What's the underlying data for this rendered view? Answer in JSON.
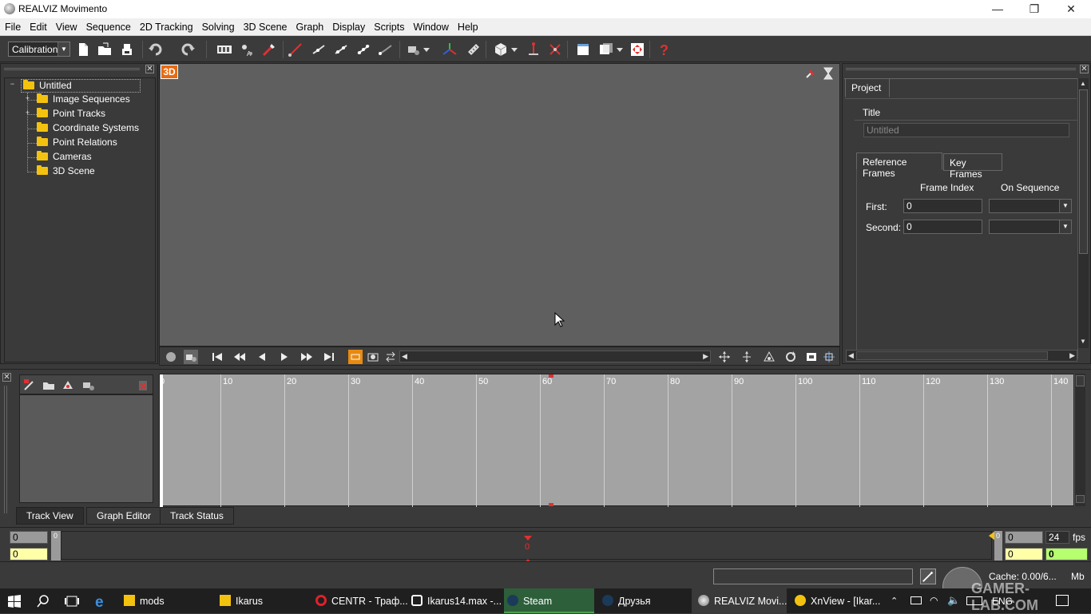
{
  "window": {
    "title": "REALVIZ Movimento",
    "minimize": "—",
    "maximize": "❐",
    "close": "✕"
  },
  "menu": [
    "File",
    "Edit",
    "View",
    "Sequence",
    "2D Tracking",
    "Solving",
    "3D Scene",
    "Graph",
    "Display",
    "Scripts",
    "Window",
    "Help"
  ],
  "toolbar": {
    "mode_select": "Calibration"
  },
  "tree": {
    "root": "Untitled",
    "items": [
      "Image Sequences",
      "Point Tracks",
      "Coordinate Systems",
      "Point Relations",
      "Cameras",
      "3D Scene"
    ]
  },
  "viewport": {
    "badge": "3D"
  },
  "project": {
    "tab": "Project",
    "title_label": "Title",
    "title_placeholder": "Untitled",
    "subtabs": [
      "Reference Frames",
      "Key Frames"
    ],
    "col_frame_index": "Frame Index",
    "col_on_sequence": "On Sequence",
    "first_label": "First:",
    "first_value": "0",
    "second_label": "Second:",
    "second_value": "0"
  },
  "track": {
    "ruler": [
      "0",
      "10",
      "20",
      "30",
      "40",
      "50",
      "60",
      "70",
      "80",
      "90",
      "100",
      "110",
      "120",
      "130",
      "140"
    ],
    "tabs": [
      "Track View",
      "Graph Editor",
      "Track Status"
    ],
    "current_marker": "0"
  },
  "timeline": {
    "left_top": "0",
    "left_bottom": "0",
    "start_marker": "0",
    "cursor_label": "0",
    "end_marker": "0",
    "right_top": "0",
    "right_bottom": "0",
    "fps_value": "24",
    "fps_label": "fps",
    "current_frame": "0"
  },
  "status": {
    "cache": "Cache: 0.00/6...",
    "mb": "Mb"
  },
  "taskbar": {
    "items": [
      "mods",
      "Ikarus",
      "CENTR - Траф...",
      "Ikarus14.max -...",
      "Steam",
      "Друзья",
      "REALVIZ Movi...",
      "XnView - [Ikar..."
    ],
    "lang": "ENG",
    "watermark": "GAMER-LAB.COM"
  },
  "colors": {
    "accent_yellow": "#f3c20f",
    "steam_green": "#4aa14f",
    "frame_green": "#b6ff6f",
    "frame_yellow": "#ffffa8"
  }
}
